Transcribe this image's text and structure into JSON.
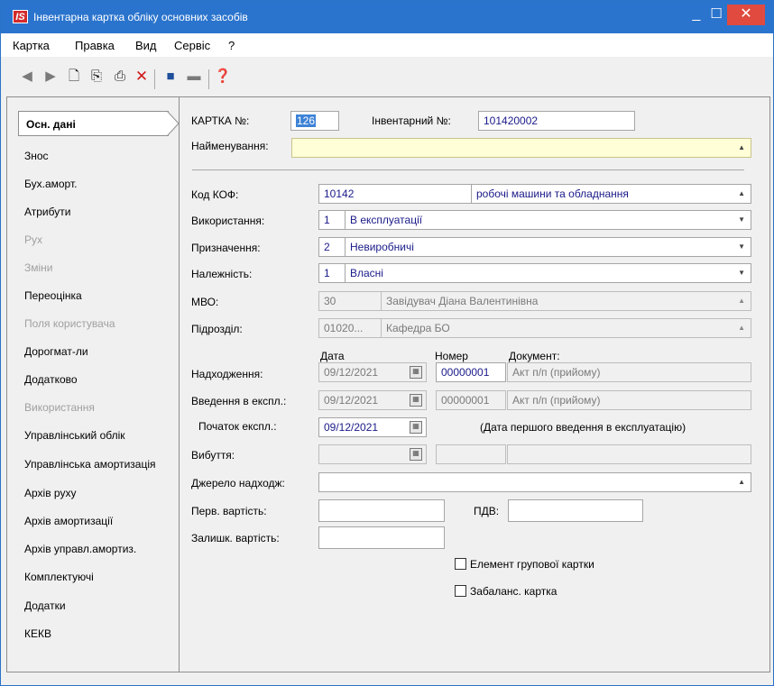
{
  "window": {
    "app_icon": "IS",
    "title": "Інвентарна картка обліку основних засобів",
    "minimize": "_",
    "maximize": "☐",
    "close": "✕"
  },
  "menu": [
    "Картка",
    "Правка",
    "Вид",
    "Сервіс",
    "?"
  ],
  "toolbar": {
    "icons": [
      "prev-record-icon",
      "next-record-icon",
      "new-doc-icon",
      "copy-doc-icon",
      "print-icon",
      "delete-icon",
      "save-icon",
      "monitor-icon",
      "help-icon"
    ],
    "accent_colors": {
      "delete": "#d01818",
      "save": "#1f4e9a"
    }
  },
  "sidebar": {
    "items": [
      {
        "label": "Осн. дані",
        "active": true,
        "enabled": true
      },
      {
        "label": "Знос",
        "enabled": true
      },
      {
        "label": "Бух.аморт.",
        "enabled": true
      },
      {
        "label": "Атрибути",
        "enabled": true
      },
      {
        "label": "Рух",
        "enabled": false
      },
      {
        "label": "Зміни",
        "enabled": false
      },
      {
        "label": "Переоцінка",
        "enabled": true
      },
      {
        "label": "Поля користувача",
        "enabled": false
      },
      {
        "label": "Дорогмат-ли",
        "enabled": true
      },
      {
        "label": "Додатково",
        "enabled": true
      },
      {
        "label": "Використання",
        "enabled": false
      },
      {
        "label": "Управлінський облік",
        "enabled": true
      },
      {
        "label": "Управлінська амортизація",
        "enabled": true
      },
      {
        "label": "Архів руху",
        "enabled": true
      },
      {
        "label": "Архів амортизації",
        "enabled": true
      },
      {
        "label": "Архів управл.амортиз.",
        "enabled": true
      },
      {
        "label": "Комплектуючі",
        "enabled": true
      },
      {
        "label": "Додатки",
        "enabled": true
      },
      {
        "label": "КЕКВ",
        "enabled": true
      }
    ]
  },
  "form": {
    "card_no": {
      "label": "КАРТКА №:",
      "value": "126"
    },
    "inv_no": {
      "label": "Інвентарний №:",
      "value": "101420002"
    },
    "name": {
      "label": "Найменування:",
      "value": ""
    },
    "kof": {
      "label": "Код КОФ:",
      "code": "10142",
      "text": "робочі машини та обладнання"
    },
    "usage": {
      "label": "Використання:",
      "code": "1",
      "text": "В експлуатації"
    },
    "purpose": {
      "label": "Призначення:",
      "code": "2",
      "text": "Невиробничі"
    },
    "ownership": {
      "label": "Належність:",
      "code": "1",
      "text": "Власні"
    },
    "mvo": {
      "label": "МВО:",
      "code": "30",
      "text": "Завідувач Діана Валентинівна"
    },
    "division": {
      "label": "Підрозділ:",
      "code": "01020...",
      "text": "Кафедра БО"
    },
    "col_date": "Дата",
    "col_number": "Номер",
    "col_document": "Документ:",
    "arrival": {
      "label": "Надходження:",
      "date": "09/12/2021",
      "number": "00000001",
      "document": "Акт п/п (прийому)"
    },
    "commissioning": {
      "label": "Введення в експл.:",
      "date": "09/12/2021",
      "number": "00000001",
      "document": "Акт п/п (прийому)"
    },
    "start_operation": {
      "label": "Початок експл.:",
      "date": "09/12/2021",
      "note": "(Дата першого введення в експлуатацію)"
    },
    "disposal": {
      "label": "Вибуття:",
      "date": "",
      "number": "",
      "document": ""
    },
    "source": {
      "label": "Джерело надходж:",
      "value": ""
    },
    "initial_cost": {
      "label": "Перв. вартість:",
      "value": ""
    },
    "vat": {
      "label": "ПДВ:",
      "value": ""
    },
    "residual_cost": {
      "label": "Залишк. вартість:",
      "value": ""
    },
    "group_card": {
      "label": "Елемент групової картки",
      "checked": false
    },
    "off_balance": {
      "label": "Забаланс.  картка",
      "checked": false
    }
  }
}
